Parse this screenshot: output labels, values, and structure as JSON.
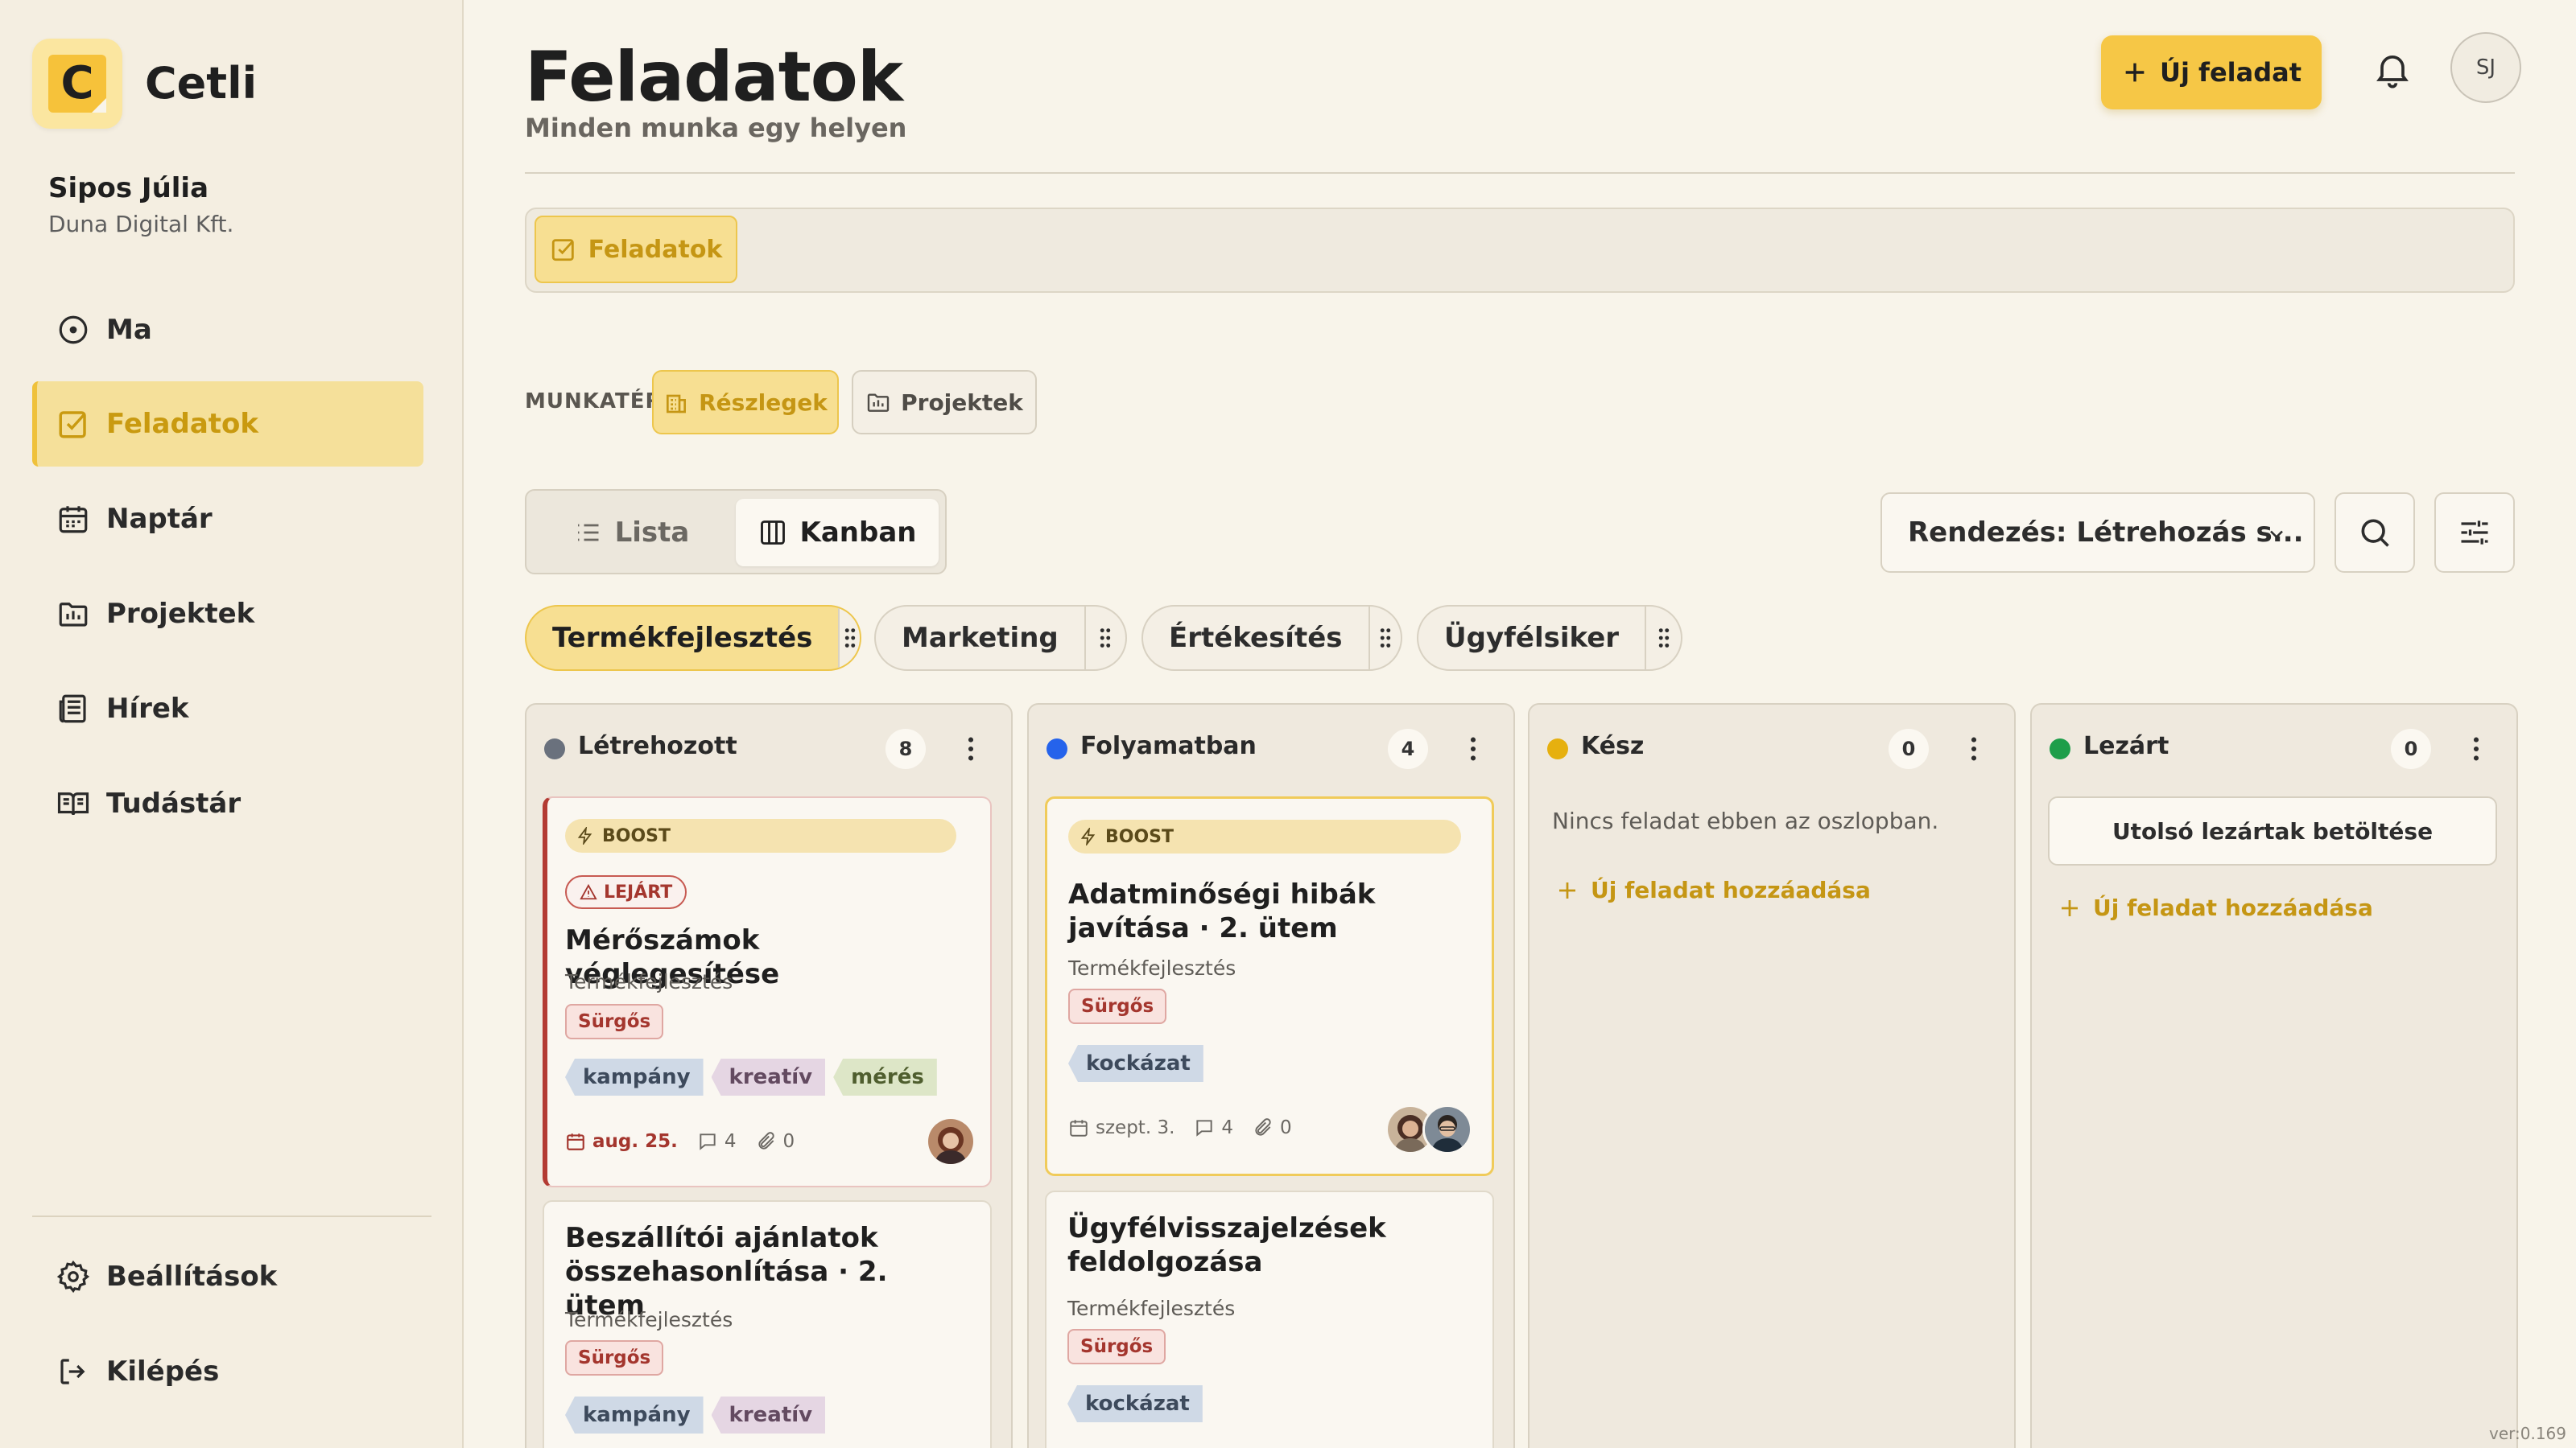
{
  "brand": {
    "name": "Cetli",
    "logo_letter": "C"
  },
  "user": {
    "name": "Sipos Júlia",
    "company": "Duna Digital Kft.",
    "initials": "SJ"
  },
  "nav": [
    {
      "label": "Ma",
      "icon": "clock-icon",
      "active": false
    },
    {
      "label": "Feladatok",
      "icon": "checkbox-icon",
      "active": true
    },
    {
      "label": "Naptár",
      "icon": "calendar-icon",
      "active": false
    },
    {
      "label": "Projektek",
      "icon": "folder-chart-icon",
      "active": false
    },
    {
      "label": "Hírek",
      "icon": "newspaper-icon",
      "active": false
    },
    {
      "label": "Tudástár",
      "icon": "book-open-icon",
      "active": false
    }
  ],
  "nav_bottom": [
    {
      "label": "Beállítások",
      "icon": "gear-icon"
    },
    {
      "label": "Kilépés",
      "icon": "logout-icon"
    }
  ],
  "page": {
    "title": "Feladatok",
    "subtitle": "Minden munka egy helyen",
    "new_task_label": "Új feladat"
  },
  "tabbar": {
    "active_tab": "Feladatok"
  },
  "workspace": {
    "label": "MUNKATÉR",
    "options": [
      "Részlegek",
      "Projektek"
    ],
    "selected": "Részlegek"
  },
  "view": {
    "options": [
      "Lista",
      "Kanban"
    ],
    "selected": "Kanban"
  },
  "sort": {
    "label": "Rendezés: Létrehozás s..."
  },
  "departments": [
    {
      "label": "Termékfejlesztés",
      "active": true
    },
    {
      "label": "Marketing",
      "active": false
    },
    {
      "label": "Értékesítés",
      "active": false
    },
    {
      "label": "Ügyfélsiker",
      "active": false
    }
  ],
  "colors": {
    "accent": "#f6c746",
    "accent_text": "#c59614",
    "overdue": "#b33b33",
    "col_created": "#6a717d",
    "col_progress": "#2563eb",
    "col_done": "#e6b00f",
    "col_closed": "#1e9e4a"
  },
  "columns": [
    {
      "title": "Létrehozott",
      "count": "8",
      "color": "#6a717d"
    },
    {
      "title": "Folyamatban",
      "count": "4",
      "color": "#2563eb"
    },
    {
      "title": "Kész",
      "count": "0",
      "color": "#e6b00f",
      "empty_text": "Nincs feladat ebben az oszlopban.",
      "add_label": "Új feladat hozzáadása"
    },
    {
      "title": "Lezárt",
      "count": "0",
      "color": "#1e9e4a",
      "load_label": "Utolsó lezártak betöltése",
      "add_label": "Új feladat hozzáadása"
    }
  ],
  "cards": {
    "c1": {
      "boost": "BOOST",
      "overdue": "LEJÁRT",
      "title": "Mérőszámok véglegesítése",
      "project": "Termékfejlesztés",
      "priority": "Sürgős",
      "tags": [
        "kampány",
        "kreatív",
        "mérés"
      ],
      "date": "aug. 25.",
      "comments": "4",
      "attachments": "0"
    },
    "c2": {
      "title": "Beszállítói ajánlatok összehasonlítása · 2. ütem",
      "project": "Termékfejlesztés",
      "priority": "Sürgős",
      "tags": [
        "kampány",
        "kreatív"
      ]
    },
    "c3": {
      "boost": "BOOST",
      "title": "Adatminőségi hibák javítása · 2. ütem",
      "project": "Termékfejlesztés",
      "priority": "Sürgős",
      "tags": [
        "kockázat"
      ],
      "date": "szept. 3.",
      "comments": "4",
      "attachments": "0"
    },
    "c4": {
      "title": "Ügyfélvisszajelzések feldolgozása",
      "project": "Termékfejlesztés",
      "priority": "Sürgős",
      "tags": [
        "kockázat"
      ]
    }
  },
  "version": "ver:0.169"
}
